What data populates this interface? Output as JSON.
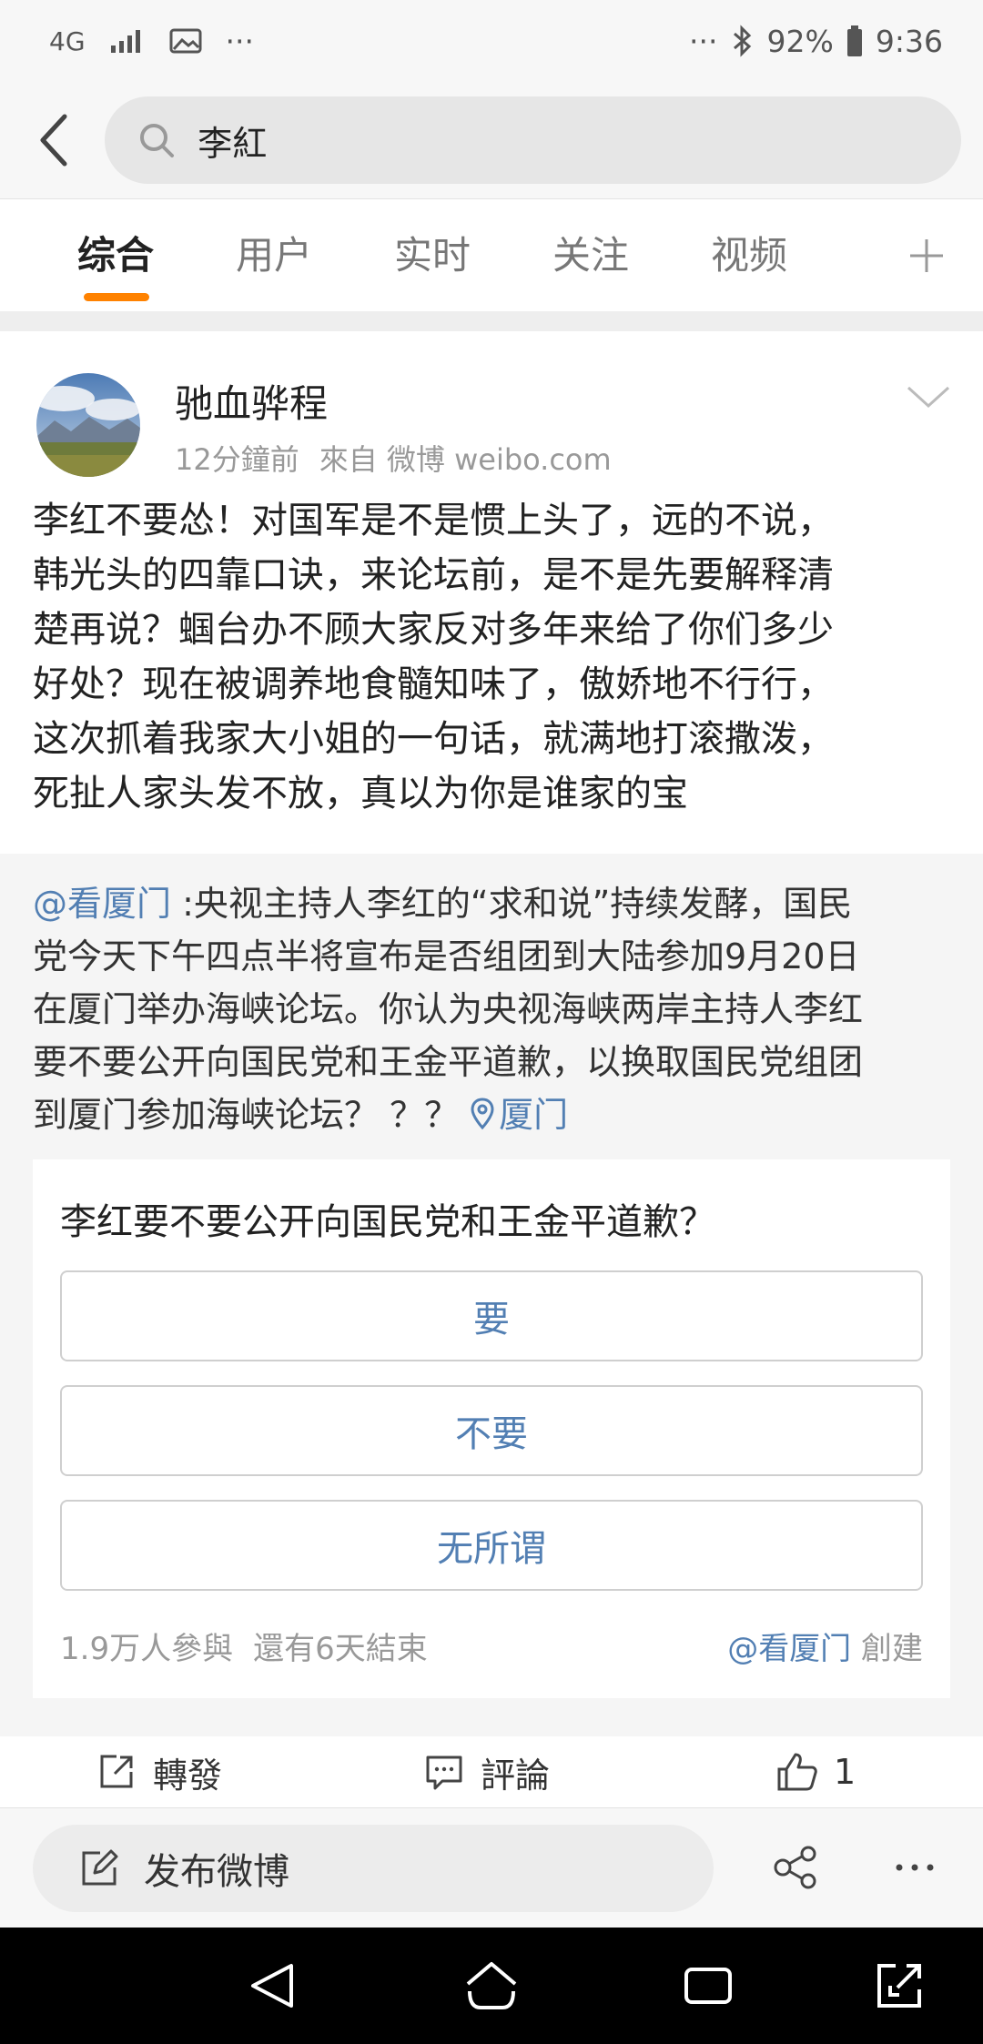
{
  "status_bar": {
    "network": "4G",
    "left_more": "···",
    "right_more": "···",
    "battery": "92%",
    "time": "9:36"
  },
  "search": {
    "query": "李紅"
  },
  "tabs": [
    "综合",
    "用户",
    "实时",
    "关注",
    "视频"
  ],
  "post": {
    "author": "驰血骅程",
    "time": "12分鐘前",
    "source": "來自 微博 weibo.com",
    "lines": [
      "李红不要怂！对国军是不是惯上头了，远的不说，",
      "韩光头的四靠口诀，来论坛前，是不是先要解释清",
      "楚再说？蝈台办不顾大家反对多年来给了你们多少",
      "好处？现在被调养地食髓知味了，傲娇地不行行，",
      "这次抓着我家大小姐的一句话，就满地打滚撒泼，",
      "死扯人家头发不放，真以为你是谁家的宝"
    ],
    "repost": {
      "mention": "@看厦门",
      "line1_rest": " :央视主持人李红的“求和说”持续发酵，国民",
      "lines": [
        "党今天下午四点半将宣布是否组团到大陆参加9月20日",
        "在厦门举办海峡论坛。你认为央视海峡两岸主持人李红",
        "要不要公开向国民党和王金平道歉，以换取国民党组团"
      ],
      "last_line": "到厦门参加海峡论坛？ ？？ ",
      "location": "厦门"
    },
    "poll": {
      "question": "李红要不要公开向国民党和王金平道歉？",
      "options": [
        "要",
        "不要",
        "无所谓"
      ],
      "participants": "1.9万人參與",
      "remaining": "還有6天結束",
      "creator": "@看厦门",
      "created_label": " 創建"
    },
    "actions": {
      "repost": "轉發",
      "comment": "評論",
      "likes": "1"
    }
  },
  "compose": {
    "label": "发布微博"
  },
  "colors": {
    "accent": "#ff8200",
    "link": "#527fb3"
  }
}
